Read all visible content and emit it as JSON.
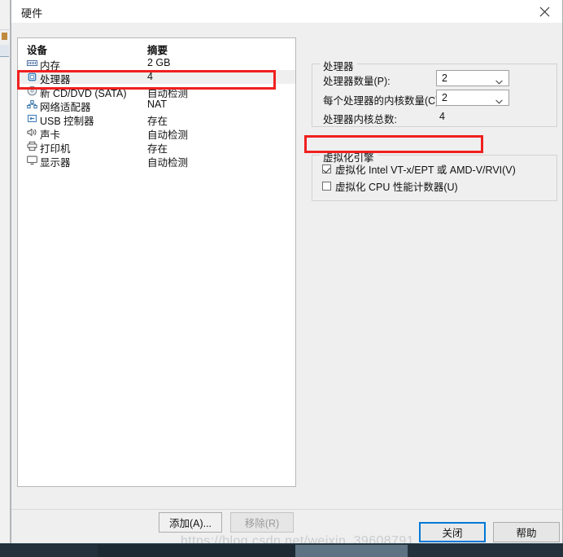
{
  "window": {
    "title": "硬件",
    "close_icon": "close-icon"
  },
  "device_list": {
    "columns": {
      "device": "设备",
      "summary": "摘要"
    },
    "rows": [
      {
        "icon": "memory-icon",
        "label": "内存",
        "summary": "2 GB",
        "selected": false
      },
      {
        "icon": "processor-icon",
        "label": "处理器",
        "summary": "4",
        "selected": true
      },
      {
        "icon": "cd-dvd-icon",
        "label": "新 CD/DVD (SATA)",
        "summary": "自动检测",
        "selected": false
      },
      {
        "icon": "network-adapter-icon",
        "label": "网络适配器",
        "summary": "NAT",
        "selected": false
      },
      {
        "icon": "usb-controller-icon",
        "label": "USB 控制器",
        "summary": "存在",
        "selected": false
      },
      {
        "icon": "sound-card-icon",
        "label": "声卡",
        "summary": "自动检测",
        "selected": false
      },
      {
        "icon": "printer-icon",
        "label": "打印机",
        "summary": "存在",
        "selected": false
      },
      {
        "icon": "display-icon",
        "label": "显示器",
        "summary": "自动检测",
        "selected": false
      }
    ]
  },
  "processor_group": {
    "legend": "处理器",
    "processor_count_label": "处理器数量(P):",
    "processor_count_value": "2",
    "cores_per_processor_label": "每个处理器的内核数量(C):",
    "cores_per_processor_value": "2",
    "total_cores_label": "处理器内核总数:",
    "total_cores_value": "4"
  },
  "virtualization_group": {
    "legend": "虚拟化引擎",
    "vt_checkbox_label": "虚拟化 Intel VT-x/EPT 或 AMD-V/RVI(V)",
    "vt_checkbox_checked": true,
    "cpu_counters_checkbox_label": "虚拟化 CPU 性能计数器(U)",
    "cpu_counters_checkbox_checked": false
  },
  "list_buttons": {
    "add_label": "添加(A)...",
    "remove_label": "移除(R)",
    "remove_disabled": true
  },
  "footer_buttons": {
    "close_label": "关闭",
    "help_label": "帮助"
  },
  "annotations": {
    "color": "#f02020",
    "boxes": [
      "processor-row",
      "vt-checkbox"
    ]
  },
  "watermark": {
    "text": "https://blog.csdn.net/weixin_39608791"
  }
}
